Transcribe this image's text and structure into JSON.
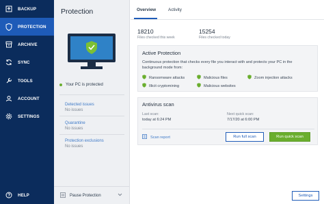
{
  "nav": {
    "items": [
      {
        "label": "BACKUP",
        "icon": "backup-icon"
      },
      {
        "label": "PROTECTION",
        "icon": "shield-icon",
        "active": true
      },
      {
        "label": "ARCHIVE",
        "icon": "archive-icon"
      },
      {
        "label": "SYNC",
        "icon": "sync-icon"
      },
      {
        "label": "TOOLS",
        "icon": "tools-icon"
      },
      {
        "label": "ACCOUNT",
        "icon": "account-icon"
      },
      {
        "label": "SETTINGS",
        "icon": "settings-icon"
      }
    ],
    "help": {
      "label": "HELP",
      "icon": "help-icon"
    }
  },
  "side": {
    "title": "Protection",
    "status": "Your PC is protected",
    "detected": {
      "label": "Detected issues",
      "value": "No issues"
    },
    "quarantine": {
      "label": "Quarantine",
      "value": "No issues"
    },
    "exclusions": {
      "label": "Protection exclusions",
      "value": "No issues"
    },
    "pause_label": "Pause Protection"
  },
  "tabs": {
    "overview": "Overview",
    "activity": "Activity"
  },
  "counts": {
    "checked_week": "18210",
    "checked_week_label": "Files checked this week",
    "checked_today": "15254",
    "checked_today_label": "Files checked today"
  },
  "active_protection": {
    "title": "Active Protection",
    "description": "Continuous protection that checks every file you interact with and protects your PC in the background mode from:",
    "features": [
      "Ransomware attacks",
      "Malicious files",
      "Zoom injection attacks",
      "Illicit cryptomining",
      "Malicious websites"
    ]
  },
  "antivirus": {
    "title": "Antivirus scan",
    "last_label": "Last scan:",
    "last_value": "today at 6:24 PM",
    "next_label": "Next quick scan:",
    "next_value": "7/17/20 at 6:00 PM",
    "report_label": "Scan report",
    "full_scan_label": "Run full scan",
    "quick_scan_label": "Run quick scan"
  },
  "settings_label": "Settings",
  "colors": {
    "nav_bg": "#0b2c5c",
    "nav_active": "#1e5bb8",
    "accent": "#1e5bb8",
    "green": "#6aae2e"
  }
}
